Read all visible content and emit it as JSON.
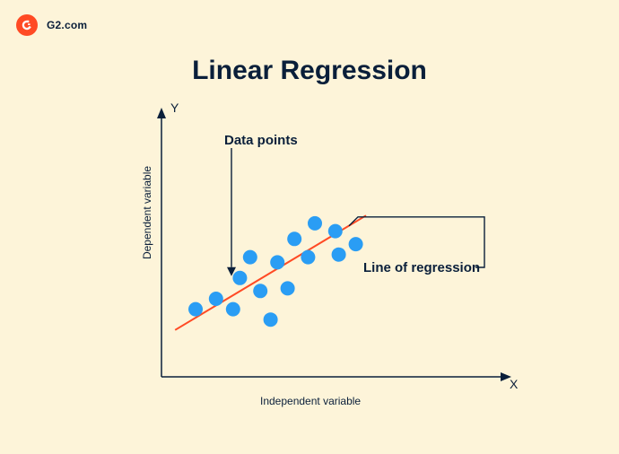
{
  "header": {
    "brand": "G2.com"
  },
  "title": "Linear Regression",
  "annotations": {
    "data_points": "Data points",
    "regression_line": "Line of regression"
  },
  "axes": {
    "y_letter": "Y",
    "x_letter": "X",
    "y_label": "Dependent variable",
    "x_label": "Independent variable"
  },
  "chart_data": {
    "type": "scatter",
    "title": "Linear Regression",
    "xlabel": "Independent variable",
    "ylabel": "Dependent variable",
    "series": [
      {
        "name": "Data points",
        "type": "scatter",
        "points": [
          {
            "x": 1.0,
            "y": 2.6
          },
          {
            "x": 1.6,
            "y": 3.0
          },
          {
            "x": 2.1,
            "y": 2.6
          },
          {
            "x": 2.3,
            "y": 3.8
          },
          {
            "x": 2.6,
            "y": 4.6
          },
          {
            "x": 2.9,
            "y": 3.3
          },
          {
            "x": 3.2,
            "y": 2.2
          },
          {
            "x": 3.4,
            "y": 4.4
          },
          {
            "x": 3.7,
            "y": 3.4
          },
          {
            "x": 3.9,
            "y": 5.3
          },
          {
            "x": 4.3,
            "y": 4.6
          },
          {
            "x": 4.5,
            "y": 5.9
          },
          {
            "x": 5.1,
            "y": 5.6
          },
          {
            "x": 5.2,
            "y": 4.7
          },
          {
            "x": 5.7,
            "y": 5.1
          }
        ]
      },
      {
        "name": "Line of regression",
        "type": "line",
        "points": [
          {
            "x": 0.4,
            "y": 1.8
          },
          {
            "x": 6.0,
            "y": 6.2
          }
        ]
      }
    ],
    "xlim": [
      0,
      10
    ],
    "ylim": [
      0,
      10
    ],
    "colors": {
      "scatter": "#2a9df4",
      "line": "#ff4a24",
      "axis": "#0a1f3a"
    }
  }
}
